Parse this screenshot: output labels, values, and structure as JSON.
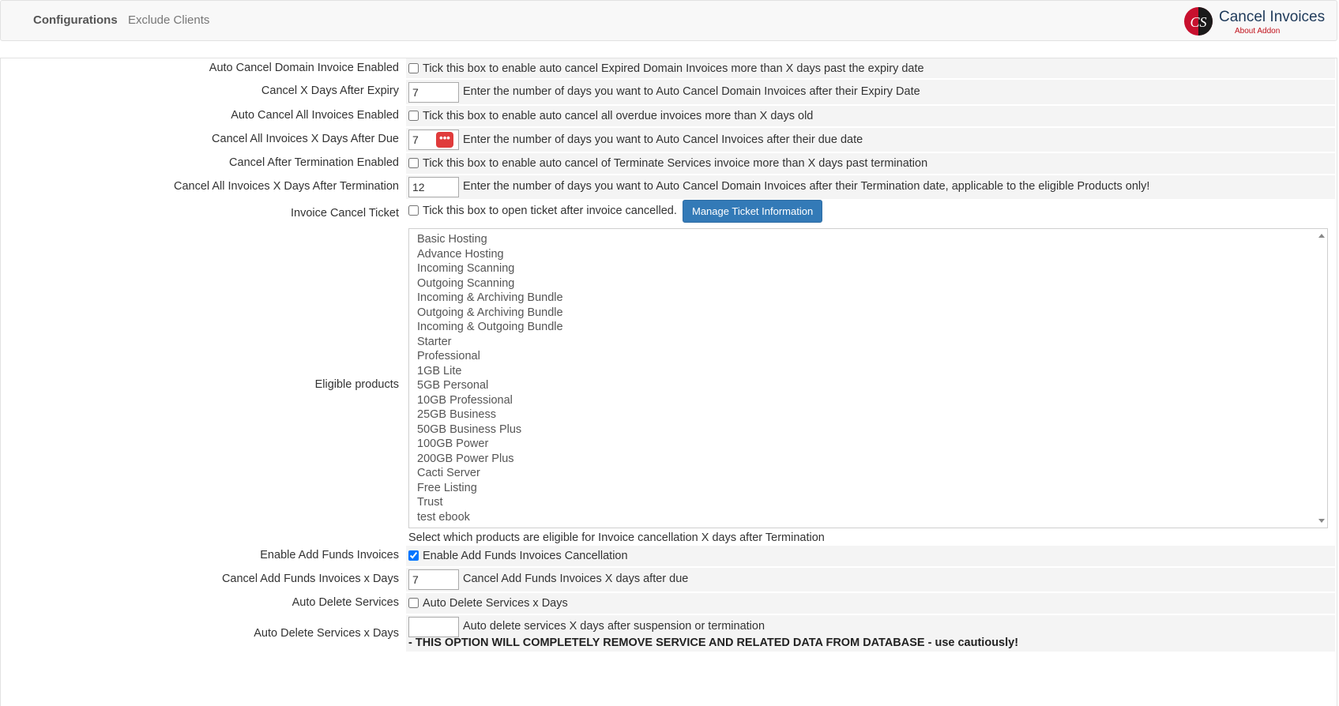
{
  "nav": {
    "tabs": [
      "Configurations",
      "Exclude Clients"
    ],
    "logo_title": "Cancel Invoices",
    "logo_subtitle": "About Addon",
    "logo_mark": "CS"
  },
  "settings": {
    "auto_cancel_domain": {
      "label": "Auto Cancel Domain Invoice Enabled",
      "description": "Tick this box to enable auto cancel Expired Domain Invoices more than X days past the expiry date",
      "checked": false
    },
    "cancel_days_after_expiry": {
      "label": "Cancel X Days After Expiry",
      "value": "7",
      "description": "Enter the number of days you want to Auto Cancel Domain Invoices after their Expiry Date"
    },
    "auto_cancel_all": {
      "label": "Auto Cancel All Invoices Enabled",
      "description": "Tick this box to enable auto cancel all overdue invoices more than X days old",
      "checked": false
    },
    "cancel_all_days_after_due": {
      "label": "Cancel All Invoices X Days After Due",
      "value": "7",
      "badge": "•••",
      "description": "Enter the number of days you want to Auto Cancel Invoices after their due date"
    },
    "cancel_after_termination": {
      "label": "Cancel After Termination Enabled",
      "description": "Tick this box to enable auto cancel of Terminate Services invoice more than X days past termination",
      "checked": false
    },
    "cancel_all_days_after_termination": {
      "label": "Cancel All Invoices X Days After Termination",
      "value": "12",
      "description": "Enter the number of days you want to Auto Cancel Domain Invoices after their Termination date, applicable to the eligible Products only!"
    },
    "invoice_cancel_ticket": {
      "label": "Invoice Cancel Ticket",
      "description": "Tick this box to open ticket after invoice cancelled.",
      "button": "Manage Ticket Information",
      "checked": false
    },
    "eligible_products": {
      "label": "Eligible products",
      "items": [
        "Basic Hosting",
        "Advance Hosting",
        "Incoming Scanning",
        "Outgoing Scanning",
        "Incoming & Archiving Bundle",
        "Outgoing & Archiving Bundle",
        "Incoming & Outgoing Bundle",
        "Starter",
        "Professional",
        "1GB Lite",
        "5GB Personal",
        "10GB Professional",
        "25GB Business",
        "50GB Business Plus",
        "100GB Power",
        "200GB Power Plus",
        "Cacti Server",
        "Free Listing",
        "Trust",
        "test ebook"
      ],
      "help": "Select which products are eligible for Invoice cancellation X days after Termination"
    },
    "enable_add_funds": {
      "label": "Enable Add Funds Invoices",
      "description": "Enable Add Funds Invoices Cancellation",
      "checked": true
    },
    "cancel_add_funds_days": {
      "label": "Cancel Add Funds Invoices x Days",
      "value": "7",
      "description": "Cancel Add Funds Invoices X days after due"
    },
    "auto_delete_services": {
      "label": "Auto Delete Services",
      "description": "Auto Delete Services x Days",
      "checked": false
    },
    "auto_delete_services_days": {
      "label": "Auto Delete Services x Days",
      "value": "",
      "description": "Auto delete services X days after suspension or termination",
      "warning": "- THIS OPTION WILL COMPLETELY REMOVE SERVICE AND RELATED DATA FROM DATABASE - use cautiously!"
    }
  }
}
